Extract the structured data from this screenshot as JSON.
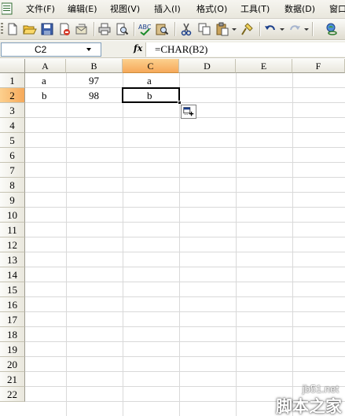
{
  "menu": [
    "文件(F)",
    "编辑(E)",
    "视图(V)",
    "插入(I)",
    "格式(O)",
    "工具(T)",
    "数据(D)",
    "窗口"
  ],
  "toolbar": {
    "buttons": [
      "new-icon",
      "open-icon",
      "save-icon",
      "permission-icon",
      "email-icon",
      "print-icon",
      "print-preview-icon",
      "spelling-icon",
      "research-icon",
      "cut-icon",
      "copy-icon",
      "paste-icon",
      "format-painter-icon",
      "undo-icon",
      "redo-icon",
      "hyperlink-icon"
    ]
  },
  "formula_bar": {
    "name_box": "C2",
    "fx_label": "fx",
    "formula": "=CHAR(B2)"
  },
  "sheet": {
    "columns": [
      "A",
      "B",
      "C",
      "D",
      "E",
      "F"
    ],
    "active_column": "C",
    "rows": [
      "1",
      "2",
      "3",
      "4",
      "5",
      "6",
      "7",
      "8",
      "9",
      "10",
      "11",
      "12",
      "13",
      "14",
      "15",
      "16",
      "17",
      "18",
      "19",
      "20",
      "21",
      "22"
    ],
    "active_row": "2",
    "selected_cell": "C2",
    "cells": {
      "A1": "a",
      "B1": "97",
      "C1": "a",
      "A2": "b",
      "B2": "98",
      "C2": "b"
    }
  },
  "watermark": {
    "url": "jb51.net",
    "text": "脚本之家"
  },
  "colors": {
    "active_header": "#f6a95a",
    "grid_line": "#d9d9d9",
    "toolbar_bg": "#e9e7dd"
  }
}
